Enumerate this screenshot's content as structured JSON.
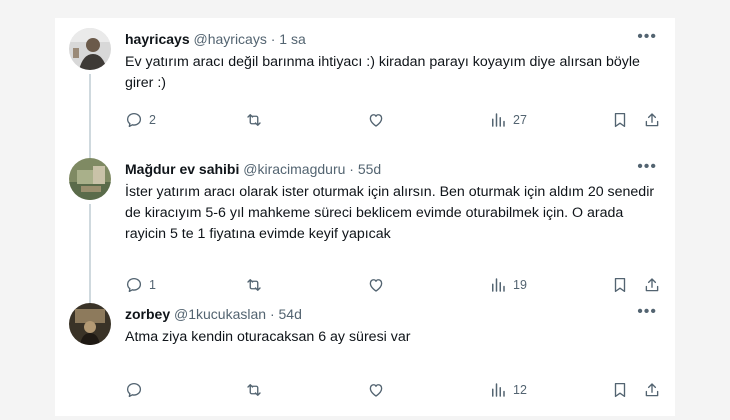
{
  "tweets": [
    {
      "name": "hayricays",
      "handle": "@hayricays",
      "time": "1 sa",
      "text": "Ev yatırım aracı değil barınma ihtiyacı :) kiradan parayı koyayım diye alırsan böyle girer :)",
      "replies": "2",
      "views": "27",
      "avatar_colors": [
        "#d8d8d8",
        "#6b5a4a",
        "#eaeaea"
      ]
    },
    {
      "name": "Mağdur ev sahibi",
      "handle": "@kiracimagduru",
      "time": "55d",
      "text": "İster yatırım aracı olarak ister oturmak için alırsın. Ben oturmak için aldım 20 senedir de kiracıyım 5-6 yıl mahkeme süreci beklicem evimde oturabilmek için. O arada rayicin 5 te 1 fiyatına evimde keyif yapıcak",
      "replies": "1",
      "views": "19",
      "avatar_colors": [
        "#7f8a63",
        "#a9b08a",
        "#5a6b4a"
      ]
    },
    {
      "name": "zorbey",
      "handle": "@1kucukaslan",
      "time": "54d",
      "text": "Atma ziya kendin oturacaksan 6 ay süresi var",
      "replies": "",
      "views": "12",
      "avatar_colors": [
        "#3a3327",
        "#8d7a5c",
        "#1f1a14"
      ]
    }
  ],
  "separator": "·",
  "more_icon": "more-horizontal-icon",
  "icon_color": "#536471",
  "thread_line_color": "#cfd9de"
}
